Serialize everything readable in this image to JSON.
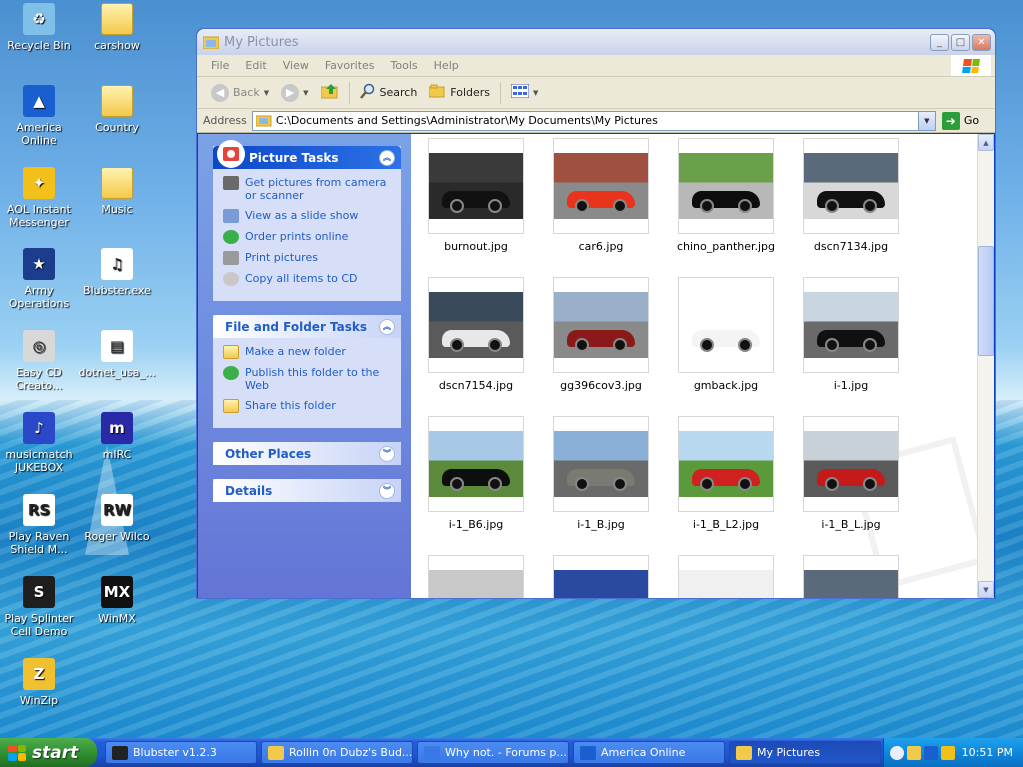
{
  "desktop": {
    "icons": [
      {
        "label": "Recycle Bin",
        "glyph": "♻",
        "color": "#7fbfe8"
      },
      {
        "label": "carshow",
        "glyph": "",
        "color": "folder"
      },
      {
        "label": "America Online",
        "glyph": "▲",
        "color": "#1a5fd0"
      },
      {
        "label": "Country",
        "glyph": "",
        "color": "folder"
      },
      {
        "label": "AOL Instant Messenger",
        "glyph": "✦",
        "color": "#f2c018"
      },
      {
        "label": "Music",
        "glyph": "",
        "color": "folder"
      },
      {
        "label": "Army Operations",
        "glyph": "★",
        "color": "#1c3c8c"
      },
      {
        "label": "Blubster.exe",
        "glyph": "♫",
        "color": "#ffffff"
      },
      {
        "label": "Easy CD Creato...",
        "glyph": "◎",
        "color": "#d8d8d8"
      },
      {
        "label": "dotnet_usa_...",
        "glyph": "▤",
        "color": "#ffffff"
      },
      {
        "label": "musicmatch JUKEBOX",
        "glyph": "♪",
        "color": "#2a48c8"
      },
      {
        "label": "mIRC",
        "glyph": "m",
        "color": "#2a2aa8"
      },
      {
        "label": "Play Raven Shield M...",
        "glyph": "RS",
        "color": "#ffffff"
      },
      {
        "label": "Roger Wilco",
        "glyph": "RW",
        "color": "#ffffff"
      },
      {
        "label": "Play Splinter Cell Demo",
        "glyph": "S",
        "color": "#1e1e1e"
      },
      {
        "label": "WinMX",
        "glyph": "MX",
        "color": "#111111"
      },
      {
        "label": "WinZip",
        "glyph": "Z",
        "color": "#f0c030"
      }
    ]
  },
  "window": {
    "title": "My Pictures",
    "menu": [
      "File",
      "Edit",
      "View",
      "Favorites",
      "Tools",
      "Help"
    ],
    "toolbar": {
      "back": "Back",
      "search": "Search",
      "folders": "Folders"
    },
    "address": {
      "label": "Address",
      "path": "C:\\Documents and Settings\\Administrator\\My Documents\\My Pictures",
      "go": "Go"
    }
  },
  "taskpane": {
    "picture_tasks": {
      "title": "Picture Tasks",
      "items": [
        "Get pictures from camera or scanner",
        "View as a slide show",
        "Order prints online",
        "Print pictures",
        "Copy all items to CD"
      ]
    },
    "file_tasks": {
      "title": "File and Folder Tasks",
      "items": [
        "Make a new folder",
        "Publish this folder to the Web",
        "Share this folder"
      ]
    },
    "other_places": {
      "title": "Other Places"
    },
    "details": {
      "title": "Details"
    }
  },
  "files": [
    {
      "name": "burnout.jpg",
      "bg": "#2a2a2a",
      "sky": "#3a3a3a",
      "car": "#111111"
    },
    {
      "name": "car6.jpg",
      "bg": "#8a8a8a",
      "sky": "#a05040",
      "car": "#e8341c"
    },
    {
      "name": "chino_panther.jpg",
      "bg": "#b8b8b8",
      "sky": "#6aa04a",
      "car": "#0d0d0d"
    },
    {
      "name": "dscn7134.jpg",
      "bg": "#d8d8d8",
      "sky": "#5a6a7a",
      "car": "#111111"
    },
    {
      "name": "dscn7154.jpg",
      "bg": "#5a5a5a",
      "sky": "#3a4a5a",
      "car": "#e8e8e8"
    },
    {
      "name": "gg396cov3.jpg",
      "bg": "#8a8a8a",
      "sky": "#9ab0c8",
      "car": "#8a1a1a"
    },
    {
      "name": "gmback.jpg",
      "bg": "#ffffff",
      "sky": "#ffffff",
      "car": "#f4f4f4"
    },
    {
      "name": "i-1.jpg",
      "bg": "#6a6a6a",
      "sky": "#c8d4e0",
      "car": "#101010"
    },
    {
      "name": "i-1_B6.jpg",
      "bg": "#5a8a3a",
      "sky": "#a8c8e8",
      "car": "#0e0e0e"
    },
    {
      "name": "i-1_B.jpg",
      "bg": "#6a6a6a",
      "sky": "#8ab0d8",
      "car": "#7a7a72"
    },
    {
      "name": "i-1_B_L2.jpg",
      "bg": "#5a9a3a",
      "sky": "#b8d8f0",
      "car": "#d02020"
    },
    {
      "name": "i-1_B_L.jpg",
      "bg": "#5a5a5a",
      "sky": "#c8d0d8",
      "car": "#c41a1a"
    },
    {
      "name": "",
      "bg": "#a0a0a0",
      "sky": "#c8c8c8",
      "car": "#707070"
    },
    {
      "name": "",
      "bg": "#1a3a8a",
      "sky": "#2a4aa0",
      "car": "#c0c8d8"
    },
    {
      "name": "",
      "bg": "#e0e0e0",
      "sky": "#f0f0f0",
      "car": "#d8d8d8"
    },
    {
      "name": "",
      "bg": "#3a3a3a",
      "sky": "#5a6a7a",
      "car": "#202020"
    }
  ],
  "taskbar": {
    "start": "start",
    "tasks": [
      {
        "label": "Blubster v1.2.3",
        "active": false
      },
      {
        "label": "Rollin 0n Dubz's Bud...",
        "active": false
      },
      {
        "label": "Why not. - Forums p...",
        "active": false
      },
      {
        "label": "America  Online",
        "active": false
      },
      {
        "label": "My Pictures",
        "active": true
      }
    ],
    "clock": "10:51 PM"
  }
}
